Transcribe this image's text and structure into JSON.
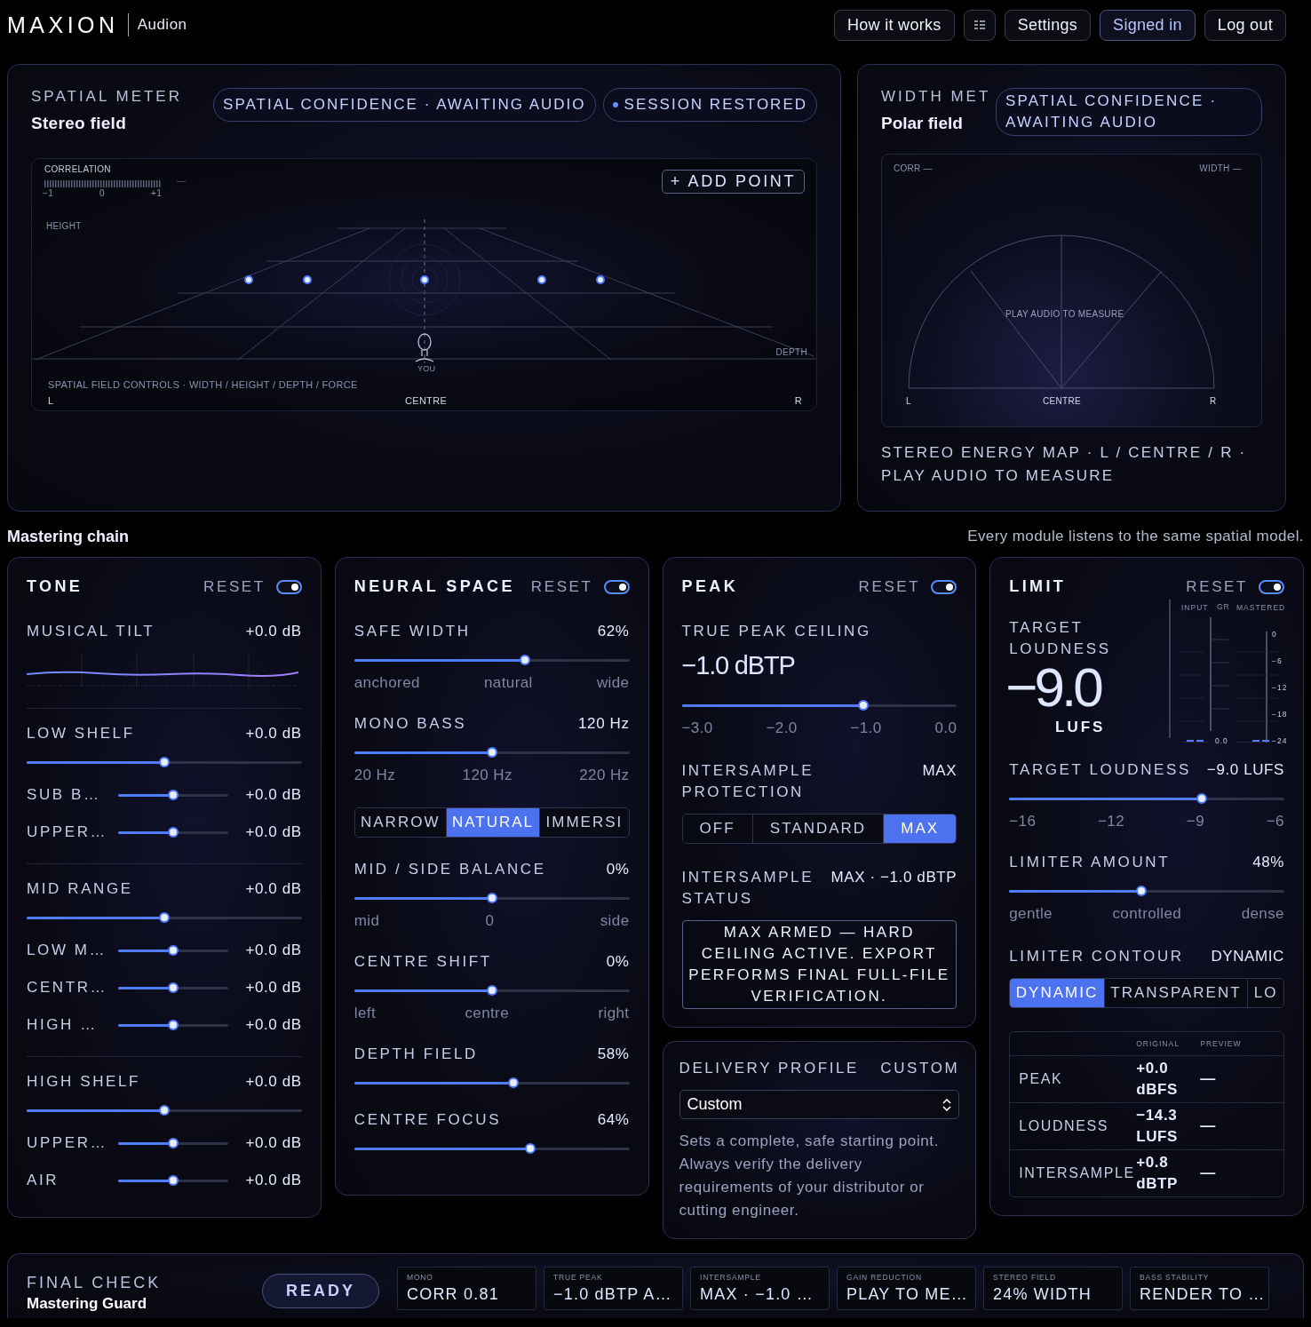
{
  "header": {
    "logo": "MAXION",
    "product": "Audion",
    "buttons": [
      {
        "kind": "text",
        "label": "How it works",
        "active": false
      },
      {
        "kind": "menu",
        "active": false
      },
      {
        "kind": "text",
        "label": "Settings",
        "active": false
      },
      {
        "kind": "text",
        "label": "Signed in",
        "active": true
      },
      {
        "kind": "text",
        "label": "Log out",
        "active": false
      }
    ]
  },
  "spatial_meter": {
    "title": "SPATIAL METER",
    "subtitle": "Stereo field",
    "badges": [
      {
        "label": "SPATIAL CONFIDENCE · AWAITING AUDIO",
        "dot": false
      },
      {
        "label": "SESSION RESTORED",
        "dot": true
      }
    ],
    "stage": {
      "correlation_label": "CORRELATION",
      "correlation_scale": [
        "−1",
        "0",
        "+1"
      ],
      "correlation_reading": "—",
      "add_button": "+ ADD POINT",
      "height_label": "HEIGHT",
      "depth_label": "DEPTH",
      "listener_label": "YOU",
      "caption": "SPATIAL FIELD CONTROLS · WIDTH / HEIGHT / DEPTH / FORCE",
      "left": "L",
      "centre": "CENTRE",
      "right": "R"
    }
  },
  "width_meter": {
    "title": "WIDTH MET",
    "subtitle": "Polar field",
    "badge": "SPATIAL CONFIDENCE · AWAITING AUDIO",
    "chart": {
      "corr": "CORR —",
      "width": "WIDTH —",
      "message": "PLAY AUDIO TO MEASURE",
      "left": "L",
      "centre": "CENTRE",
      "right": "R"
    },
    "caption": "STEREO ENERGY MAP · L / CENTRE / R · PLAY AUDIO TO MEASURE"
  },
  "chain": {
    "title": "Mastering chain",
    "note": "Every module listens to the same spatial model.",
    "columns": [
      {
        "cards": [
          {
            "kind": "module",
            "title": "TONE",
            "reset": "RESET",
            "on": true,
            "sections": [
              {
                "items": [
                  {
                    "kind": "curve",
                    "label": "MUSICAL TILT",
                    "value": "+0.0 dB"
                  }
                ]
              },
              {
                "items": [
                  {
                    "kind": "slider",
                    "label": "LOW SHELF",
                    "value": "+0.0 dB",
                    "level": 0.5
                  },
                  {
                    "kind": "subslider",
                    "label": "SUB B…",
                    "value": "+0.0 dB",
                    "level": 0.5
                  },
                  {
                    "kind": "subslider",
                    "label": "UPPER…",
                    "value": "+0.0 dB",
                    "level": 0.5
                  }
                ]
              },
              {
                "items": [
                  {
                    "kind": "slider",
                    "label": "MID RANGE",
                    "value": "+0.0 dB",
                    "level": 0.5
                  },
                  {
                    "kind": "subslider",
                    "label": "LOW M…",
                    "value": "+0.0 dB",
                    "level": 0.5
                  },
                  {
                    "kind": "subslider",
                    "label": "CENTR…",
                    "value": "+0.0 dB",
                    "level": 0.5
                  },
                  {
                    "kind": "subslider",
                    "label": "HIGH …",
                    "value": "+0.0 dB",
                    "level": 0.5
                  }
                ]
              },
              {
                "items": [
                  {
                    "kind": "slider",
                    "label": "HIGH SHELF",
                    "value": "+0.0 dB",
                    "level": 0.5
                  },
                  {
                    "kind": "subslider",
                    "label": "UPPER…",
                    "value": "+0.0 dB",
                    "level": 0.5
                  },
                  {
                    "kind": "subslider",
                    "label": "AIR",
                    "value": "+0.0 dB",
                    "level": 0.5
                  }
                ]
              }
            ]
          }
        ]
      },
      {
        "cards": [
          {
            "kind": "module",
            "title": "NEURAL SPACE",
            "reset": "RESET",
            "on": true,
            "sections": [
              {
                "items": [
                  {
                    "kind": "slider",
                    "label": "SAFE WIDTH",
                    "value": "62%",
                    "level": 0.62,
                    "ticks": [
                      "anchored",
                      "natural",
                      "wide"
                    ]
                  },
                  {
                    "kind": "slider",
                    "label": "MONO BASS",
                    "value": "120 Hz",
                    "level": 0.5,
                    "ticks": [
                      "20 Hz",
                      "120 Hz",
                      "220 Hz"
                    ]
                  },
                  {
                    "kind": "segmented",
                    "options": [
                      {
                        "label": "NARROW",
                        "selected": false
                      },
                      {
                        "label": "NATURAL",
                        "selected": true
                      },
                      {
                        "label": "IMMERSI",
                        "selected": false
                      }
                    ]
                  },
                  {
                    "kind": "slider",
                    "label": "MID / SIDE BALANCE",
                    "value": "0%",
                    "level": 0.5,
                    "ticks": [
                      "mid",
                      "0",
                      "side"
                    ]
                  },
                  {
                    "kind": "slider",
                    "label": "CENTRE SHIFT",
                    "value": "0%",
                    "level": 0.5,
                    "ticks": [
                      "left",
                      "centre",
                      "right"
                    ]
                  },
                  {
                    "kind": "slider",
                    "label": "DEPTH FIELD",
                    "value": "58%",
                    "level": 0.58
                  },
                  {
                    "kind": "slider",
                    "label": "CENTRE FOCUS",
                    "value": "64%",
                    "level": 0.64
                  }
                ]
              }
            ]
          }
        ]
      },
      {
        "cards": [
          {
            "kind": "module",
            "title": "PEAK",
            "reset": "RESET",
            "on": true,
            "sections": [
              {
                "items": [
                  {
                    "kind": "bigslider",
                    "label": "TRUE PEAK CEILING",
                    "value": "−1.0 dBTP",
                    "level": 0.66,
                    "ticks": [
                      "−3.0",
                      "−2.0",
                      "−1.0",
                      "0.0"
                    ]
                  },
                  {
                    "kind": "status",
                    "label": "INTERSAMPLE PROTECTION",
                    "value": "MAX"
                  },
                  {
                    "kind": "segmented",
                    "options": [
                      {
                        "label": "OFF",
                        "selected": false
                      },
                      {
                        "label": "STANDARD",
                        "selected": false
                      },
                      {
                        "label": "MAX",
                        "selected": true
                      }
                    ]
                  },
                  {
                    "kind": "status",
                    "label": "INTERSAMPLE STATUS",
                    "value": "MAX · −1.0 dBTP"
                  },
                  {
                    "kind": "notice",
                    "text": "MAX ARMED — HARD CEILING ACTIVE. EXPORT PERFORMS FINAL FULL-FILE VERIFICATION."
                  }
                ]
              }
            ]
          },
          {
            "kind": "profile",
            "title": "DELIVERY PROFILE",
            "value": "CUSTOM",
            "select": "Custom",
            "description": "Sets a complete, safe starting point. Always verify the delivery requirements of your distributor or cutting engineer."
          }
        ]
      },
      {
        "cards": [
          {
            "kind": "module",
            "title": "LIMIT",
            "reset": "RESET",
            "on": true,
            "sections": [
              {
                "items": [
                  {
                    "kind": "loudness",
                    "label": "TARGET LOUDNESS",
                    "value": "−9.0",
                    "unit": "LUFS",
                    "meter_labels": [
                      "INPUT",
                      "GR",
                      "MASTERED"
                    ],
                    "scale": [
                      "0",
                      "−6",
                      "−12",
                      "−18",
                      "−24"
                    ],
                    "gr_reading": "0.0"
                  },
                  {
                    "kind": "slider",
                    "label": "TARGET LOUDNESS",
                    "value": "−9.0 LUFS",
                    "level": 0.7,
                    "ticks": [
                      "−16",
                      "−12",
                      "−9",
                      "−6"
                    ]
                  },
                  {
                    "kind": "slider",
                    "label": "LIMITER AMOUNT",
                    "value": "48%",
                    "level": 0.48,
                    "ticks": [
                      "gentle",
                      "controlled",
                      "dense"
                    ]
                  },
                  {
                    "kind": "status",
                    "label": "LIMITER CONTOUR",
                    "value": "DYNAMIC"
                  },
                  {
                    "kind": "segmented",
                    "options": [
                      {
                        "label": "DYNAMIC",
                        "selected": true
                      },
                      {
                        "label": "TRANSPARENT",
                        "selected": false
                      },
                      {
                        "label": "LO",
                        "selected": false
                      }
                    ]
                  },
                  {
                    "kind": "table",
                    "columns": [
                      "ORIGINAL",
                      "PREVIEW"
                    ],
                    "rows": [
                      {
                        "label": "PEAK",
                        "original": "+0.0 dBFS",
                        "preview": "—"
                      },
                      {
                        "label": "LOUDNESS",
                        "original": "−14.3 LUFS",
                        "preview": "—"
                      },
                      {
                        "label": "INTERSAMPLE",
                        "original": "+0.8 dBTP",
                        "preview": "—"
                      }
                    ]
                  }
                ]
              }
            ]
          }
        ]
      }
    ]
  },
  "final_check": {
    "title": "FINAL CHECK",
    "subtitle": "Mastering Guard",
    "status": "READY",
    "tiles": [
      {
        "label": "MONO",
        "value": "CORR 0.81"
      },
      {
        "label": "TRUE PEAK",
        "value": "−1.0 dBTP A…"
      },
      {
        "label": "INTERSAMPLE",
        "value": "MAX · −1.0 …"
      },
      {
        "label": "GAIN REDUCTION",
        "value": "PLAY TO ME…"
      },
      {
        "label": "STEREO FIELD",
        "value": "24% WIDTH"
      },
      {
        "label": "BASS STABILITY",
        "value": "RENDER TO …"
      }
    ]
  }
}
